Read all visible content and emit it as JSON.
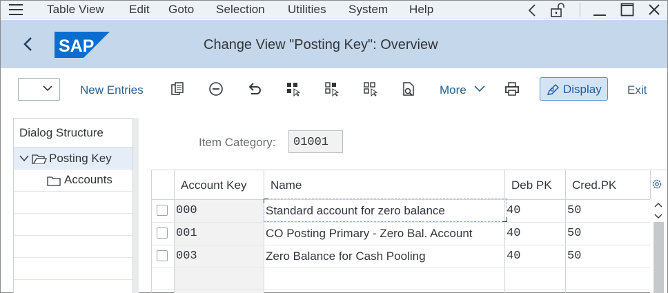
{
  "menu": {
    "items": [
      "Table View",
      "Edit",
      "Goto",
      "Selection",
      "Utilities",
      "System",
      "Help"
    ]
  },
  "title_bar": {
    "logo_text": "SAP",
    "title": "Change View \"Posting Key\": Overview"
  },
  "toolbar": {
    "new_entries": "New Entries",
    "more": "More",
    "display": "Display",
    "exit": "Exit",
    "icons": [
      "copy-icon",
      "delete-icon",
      "undo-icon",
      "select-all-icon",
      "select-block-icon",
      "deselect-all-icon",
      "details-icon",
      "print-icon"
    ]
  },
  "dialog_structure": {
    "heading": "Dialog Structure",
    "items": [
      {
        "label": "Posting Key",
        "selected": true
      },
      {
        "label": "Accounts",
        "selected": false
      }
    ]
  },
  "filter": {
    "label": "Item Category:",
    "value": "01001"
  },
  "table": {
    "columns": [
      "Account Key",
      "Name",
      "Deb PK",
      "Cred.PK"
    ],
    "rows": [
      {
        "account_key": "000",
        "name": "Standard account for zero balance",
        "deb_pk": "40",
        "cred_pk": "50"
      },
      {
        "account_key": "001",
        "name": "CO Posting Primary - Zero Bal. Account",
        "deb_pk": "40",
        "cred_pk": "50"
      },
      {
        "account_key": "003",
        "name": "Zero Balance for Cash Pooling",
        "deb_pk": "40",
        "cred_pk": "50"
      }
    ]
  },
  "colors": {
    "menubar_bg": "#edf2f7",
    "titlebar_bg": "#c4d7eb",
    "sap_logo": "#0a6ed1",
    "link_text": "#2a5f8f",
    "display_btn_bg": "#d4e3f4"
  }
}
